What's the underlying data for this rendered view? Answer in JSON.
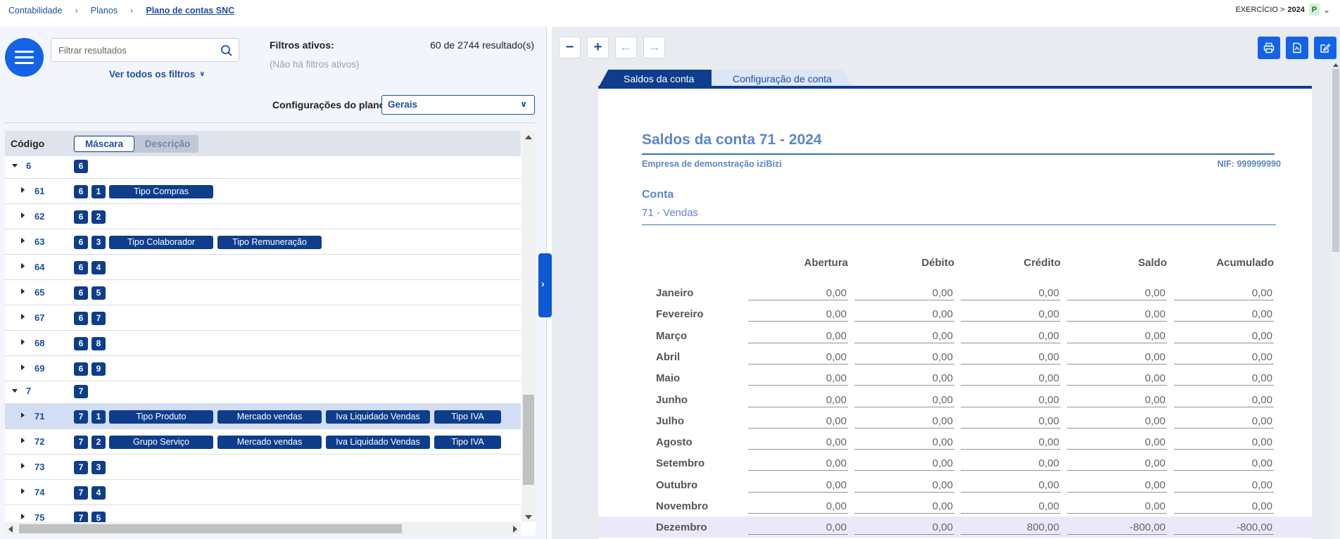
{
  "breadcrumb": [
    {
      "label": "Contabilidade",
      "current": false
    },
    {
      "label": "Planos",
      "current": false
    },
    {
      "label": "Plano de contas SNC",
      "current": true
    }
  ],
  "exercise": {
    "label": "EXERCÍCIO >",
    "year": "2024",
    "badge": "P"
  },
  "search": {
    "placeholder": "Filtrar resultados"
  },
  "filters": {
    "see_all": "Ver todos os filtros",
    "active_label": "Filtros ativos:",
    "none": "(Não há filtros ativos)",
    "result_count": "60 de 2744 resultado(s)"
  },
  "plan_config": {
    "label": "Configurações do plano:",
    "value": "Gerais"
  },
  "grid": {
    "code_header": "Código",
    "toggle": {
      "active": "Máscara",
      "inactive": "Descrição"
    },
    "rows": [
      {
        "code": "6",
        "level": 0,
        "expanded": true,
        "segments": [
          "6"
        ],
        "tags": []
      },
      {
        "code": "61",
        "level": 1,
        "segments": [
          "6",
          "1"
        ],
        "tags": [
          "Tipo Compras"
        ]
      },
      {
        "code": "62",
        "level": 1,
        "segments": [
          "6",
          "2"
        ],
        "tags": []
      },
      {
        "code": "63",
        "level": 1,
        "segments": [
          "6",
          "3"
        ],
        "tags": [
          "Tipo Colaborador",
          "Tipo Remuneração"
        ]
      },
      {
        "code": "64",
        "level": 1,
        "segments": [
          "6",
          "4"
        ],
        "tags": []
      },
      {
        "code": "65",
        "level": 1,
        "segments": [
          "6",
          "5"
        ],
        "tags": []
      },
      {
        "code": "67",
        "level": 1,
        "segments": [
          "6",
          "7"
        ],
        "tags": []
      },
      {
        "code": "68",
        "level": 1,
        "segments": [
          "6",
          "8"
        ],
        "tags": []
      },
      {
        "code": "69",
        "level": 1,
        "segments": [
          "6",
          "9"
        ],
        "tags": []
      },
      {
        "code": "7",
        "level": 0,
        "expanded": true,
        "segments": [
          "7"
        ],
        "tags": []
      },
      {
        "code": "71",
        "level": 1,
        "selected": true,
        "segments": [
          "7",
          "1"
        ],
        "tags": [
          "Tipo Produto",
          "Mercado vendas",
          "Iva Liquidado Vendas",
          "Tipo IVA"
        ]
      },
      {
        "code": "72",
        "level": 1,
        "segments": [
          "7",
          "2"
        ],
        "tags": [
          "Grupo Serviço",
          "Mercado vendas",
          "Iva Liquidado Vendas",
          "Tipo IVA"
        ]
      },
      {
        "code": "73",
        "level": 1,
        "segments": [
          "7",
          "3"
        ],
        "tags": []
      },
      {
        "code": "74",
        "level": 1,
        "segments": [
          "7",
          "4"
        ],
        "tags": []
      },
      {
        "code": "75",
        "level": 1,
        "segments": [
          "7",
          "5"
        ],
        "tags": []
      }
    ]
  },
  "tabs": [
    {
      "label": "Saldos da conta",
      "active": true
    },
    {
      "label": "Configuração de conta",
      "active": false
    }
  ],
  "report": {
    "title": "Saldos da conta 71 - 2024",
    "company": "Empresa de demonstração iziBizi",
    "nif": "NIF: 999999990",
    "account_label": "Conta",
    "account_value": "71 - Vendas",
    "columns": [
      "Abertura",
      "Débito",
      "Crédito",
      "Saldo",
      "Acumulado"
    ],
    "rows": [
      {
        "month": "Janeiro",
        "values": [
          "0,00",
          "0,00",
          "0,00",
          "0,00",
          "0,00"
        ]
      },
      {
        "month": "Fevereiro",
        "values": [
          "0,00",
          "0,00",
          "0,00",
          "0,00",
          "0,00"
        ]
      },
      {
        "month": "Março",
        "values": [
          "0,00",
          "0,00",
          "0,00",
          "0,00",
          "0,00"
        ]
      },
      {
        "month": "Abril",
        "values": [
          "0,00",
          "0,00",
          "0,00",
          "0,00",
          "0,00"
        ]
      },
      {
        "month": "Maio",
        "values": [
          "0,00",
          "0,00",
          "0,00",
          "0,00",
          "0,00"
        ]
      },
      {
        "month": "Junho",
        "values": [
          "0,00",
          "0,00",
          "0,00",
          "0,00",
          "0,00"
        ]
      },
      {
        "month": "Julho",
        "values": [
          "0,00",
          "0,00",
          "0,00",
          "0,00",
          "0,00"
        ]
      },
      {
        "month": "Agosto",
        "values": [
          "0,00",
          "0,00",
          "0,00",
          "0,00",
          "0,00"
        ]
      },
      {
        "month": "Setembro",
        "values": [
          "0,00",
          "0,00",
          "0,00",
          "0,00",
          "0,00"
        ]
      },
      {
        "month": "Outubro",
        "values": [
          "0,00",
          "0,00",
          "0,00",
          "0,00",
          "0,00"
        ]
      },
      {
        "month": "Novembro",
        "values": [
          "0,00",
          "0,00",
          "0,00",
          "0,00",
          "0,00"
        ]
      },
      {
        "month": "Dezembro",
        "highlight": true,
        "values": [
          "0,00",
          "0,00",
          "800,00",
          "-800,00",
          "-800,00"
        ]
      }
    ]
  },
  "colors": {
    "primary": "#1463e6",
    "navy": "#0e3d8c",
    "link": "#1e4fa3",
    "report_text": "#5c87c6"
  }
}
